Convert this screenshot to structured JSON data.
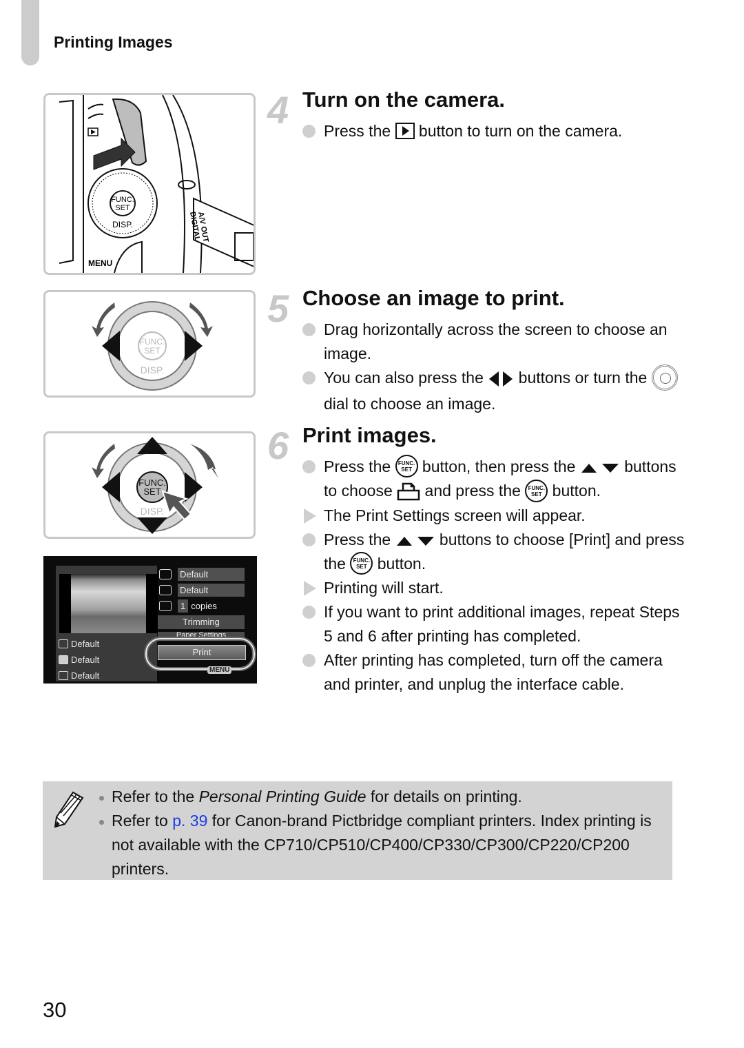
{
  "header": {
    "section_title": "Printing Images"
  },
  "steps": [
    {
      "number": "4",
      "title": "Turn on the camera.",
      "items": [
        {
          "type": "bullet",
          "parts": [
            "Press the ",
            " button to turn on the camera."
          ],
          "icons": [
            "playback-button-icon"
          ]
        }
      ]
    },
    {
      "number": "5",
      "title": "Choose an image to print.",
      "items": [
        {
          "type": "bullet",
          "text": "Drag horizontally across the screen to choose an image."
        },
        {
          "type": "bullet",
          "parts": [
            "You can also press the ",
            " buttons or turn the ",
            " dial to choose an image."
          ],
          "icons": [
            "left-right-arrow-icon",
            "control-dial-icon"
          ]
        }
      ]
    },
    {
      "number": "6",
      "title": "Print images.",
      "items": [
        {
          "type": "bullet",
          "parts": [
            "Press the ",
            " button, then press the ",
            " buttons to choose ",
            " and press the ",
            " button."
          ],
          "icons": [
            "func-set-icon",
            "up-down-arrow-icon",
            "print-icon",
            "func-set-icon"
          ]
        },
        {
          "type": "result",
          "text": "The Print Settings screen will appear."
        },
        {
          "type": "bullet",
          "parts": [
            "Press the ",
            " buttons to choose [Print] and press the ",
            " button."
          ],
          "icons": [
            "up-down-arrow-icon",
            "func-set-icon"
          ]
        },
        {
          "type": "result",
          "text": "Printing will start."
        },
        {
          "type": "bullet",
          "text": "If you want to print additional images, repeat Steps 5 and 6 after printing has completed."
        },
        {
          "type": "bullet",
          "text": "After printing has completed, turn off the camera and printer, and unplug the interface cable."
        }
      ]
    }
  ],
  "figures": {
    "camera_labels": {
      "func": "FUNC.",
      "set": "SET",
      "disp": "DISP.",
      "menu": "MENU",
      "av_out": "A/V OUT",
      "digital": "DIGITAL"
    }
  },
  "lcd_screen": {
    "left_rows": [
      "Default",
      "Default",
      "Default"
    ],
    "right_rows": [
      {
        "icon": "date-icon",
        "value": "Default"
      },
      {
        "icon": "image-icon",
        "value": "Default"
      },
      {
        "icon": "copies-icon",
        "count": "1",
        "value": "copies"
      }
    ],
    "buttons": [
      "Trimming",
      "Paper Settings",
      "Print"
    ],
    "menu_label": "MENU"
  },
  "note": {
    "items": [
      {
        "pre": "Refer to the ",
        "italic": "Personal Printing Guide",
        "post": " for details on printing."
      },
      {
        "pre": "Refer to ",
        "link": "p. 39",
        "post": " for Canon-brand Pictbridge compliant printers. Index printing is not available with the CP710/CP510/CP400/CP330/CP300/CP220/CP200 printers."
      }
    ],
    "link_color": "#1c3ee6"
  },
  "footer": {
    "page_number": "30"
  }
}
